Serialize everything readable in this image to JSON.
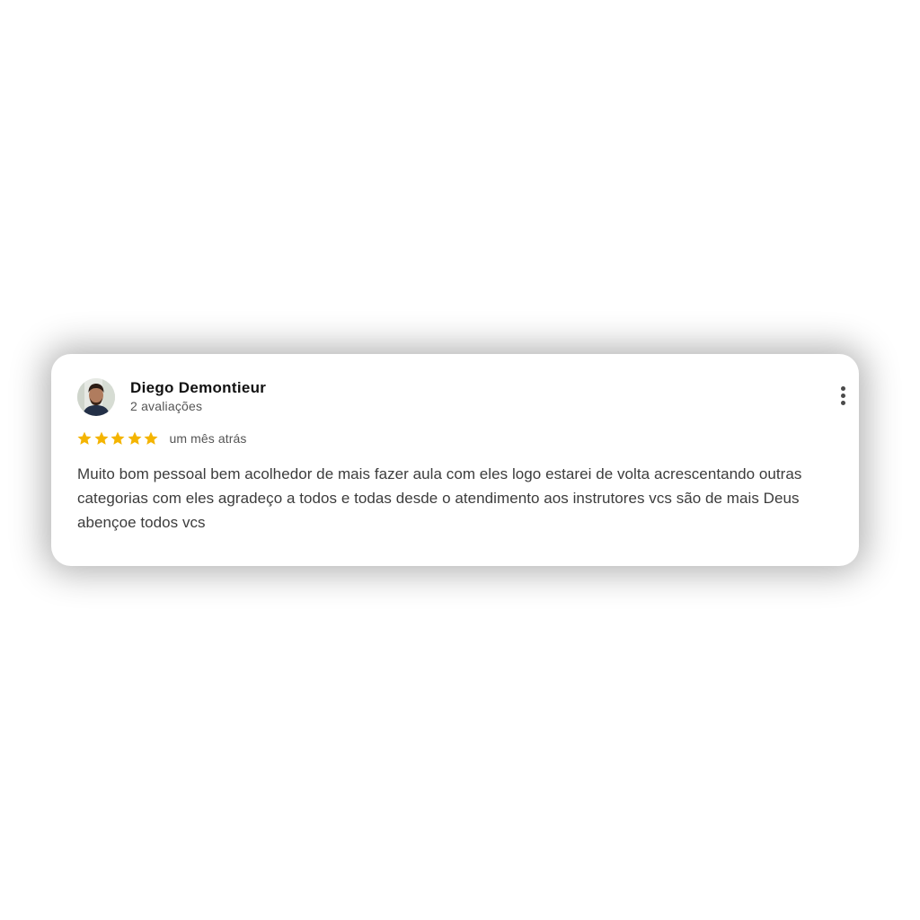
{
  "review": {
    "reviewer_name": "Diego Demontieur",
    "review_count": "2 avaliações",
    "rating": 5,
    "rating_max": 5,
    "date": "um mês atrás",
    "text": "Muito bom pessoal bem acolhedor de mais fazer aula com eles logo estarei de volta acrescentando outras categorias com eles agradeço a todos e todas desde o atendimento aos instrutores vcs são de mais Deus abençoe todos vcs",
    "more_icon": "more-vert-icon",
    "star_icon": "star-icon"
  },
  "colors": {
    "star": "#F4B400",
    "name": "#111111",
    "meta": "#555555",
    "body": "#3c3c3c"
  }
}
